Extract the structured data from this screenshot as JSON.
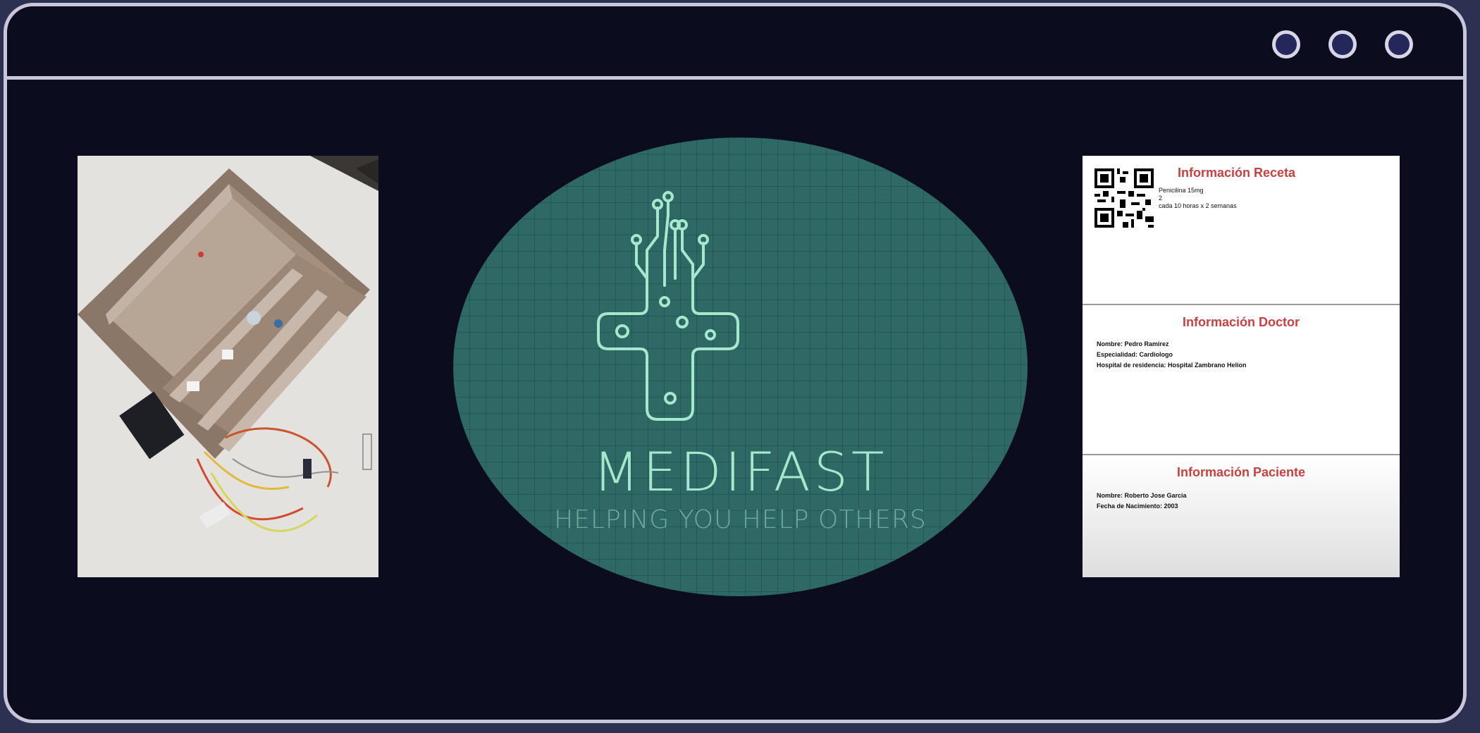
{
  "window": {
    "controls": [
      "window-dot-1",
      "window-dot-2",
      "window-dot-3"
    ]
  },
  "logo": {
    "title": "MEDIFAST",
    "subtitle": "HELPING YOU HELP OTHERS"
  },
  "document": {
    "receta": {
      "title": "Información Receta",
      "lines": [
        "Penicilina 15mg",
        "2",
        "cada 10 horas x 2 semanas"
      ]
    },
    "doctor": {
      "title": "Información Doctor",
      "lines": [
        "Nombre: Pedro Ramirez",
        "Especialidad: Cardiologo",
        "Hospital de residencia: Hospital Zambrano Helion"
      ]
    },
    "paciente": {
      "title": "Información Paciente",
      "lines": [
        "Nombre: Roberto Jose Garcia",
        "Fecha de Nacimiento: 2003"
      ]
    }
  },
  "colors": {
    "window_bg": "#0b0c1e",
    "frame": "#c9c6dc",
    "logo_bg": "#2e6965",
    "logo_accent": "#a6e8ce",
    "section_title": "#c94040"
  }
}
